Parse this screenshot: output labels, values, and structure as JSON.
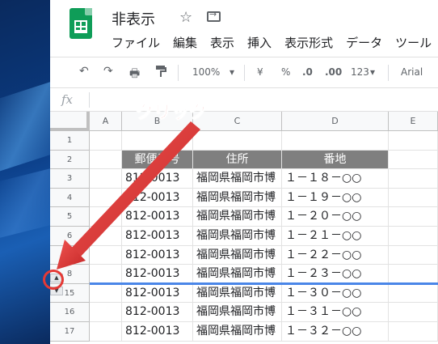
{
  "document": {
    "title": "非表示"
  },
  "menu": [
    "ファイル",
    "編集",
    "表示",
    "挿入",
    "表示形式",
    "データ",
    "ツール"
  ],
  "toolbar": {
    "undo_icon": "undo-icon",
    "redo_icon": "redo-icon",
    "print_icon": "print-icon",
    "paint_format_icon": "paint-format-icon",
    "zoom": "100%",
    "currency": "¥",
    "percent": "%",
    "decrease_decimal": ".0",
    "increase_decimal": ".00",
    "more_formats": "123",
    "font": "Arial"
  },
  "formula_bar": {
    "fx": "fx",
    "value": ""
  },
  "columns": [
    "A",
    "B",
    "C",
    "D",
    "E"
  ],
  "rows": [
    {
      "num": "1",
      "cells": [
        "",
        "",
        "",
        ""
      ]
    },
    {
      "num": "2",
      "cells": [
        "",
        "郵便番号",
        "住所",
        "番地"
      ],
      "header": true
    },
    {
      "num": "3",
      "cells": [
        "",
        "812-0013",
        "福岡県福岡市博",
        "１－１８－○○"
      ]
    },
    {
      "num": "4",
      "cells": [
        "",
        "812-0013",
        "福岡県福岡市博",
        "１－１９－○○"
      ]
    },
    {
      "num": "5",
      "cells": [
        "",
        "812-0013",
        "福岡県福岡市博",
        "１－２０－○○"
      ]
    },
    {
      "num": "6",
      "cells": [
        "",
        "812-0013",
        "福岡県福岡市博",
        "１－２１－○○"
      ]
    },
    {
      "num": "7",
      "cells": [
        "",
        "812-0013",
        "福岡県福岡市博",
        "１－２２－○○"
      ]
    },
    {
      "num": "8",
      "cells": [
        "",
        "812-0013",
        "福岡県福岡市博",
        "１－２３－○○"
      ]
    },
    {
      "num": "15",
      "cells": [
        "",
        "812-0013",
        "福岡県福岡市博",
        "１－３０－○○"
      ]
    },
    {
      "num": "16",
      "cells": [
        "",
        "812-0013",
        "福岡県福岡市博",
        "１－３１－○○"
      ]
    },
    {
      "num": "17",
      "cells": [
        "",
        "812-0013",
        "福岡県福岡市博",
        "１－３２－○○"
      ]
    }
  ],
  "annotation": {
    "callout": "クリック",
    "arrow_color": "#e53935"
  },
  "unhide": {
    "up": "▲",
    "down": "▼"
  },
  "colors": {
    "header_fill": "#7f7f7f",
    "hidden_marker": "#4a86e8",
    "sheets_green": "#0f9d58"
  }
}
